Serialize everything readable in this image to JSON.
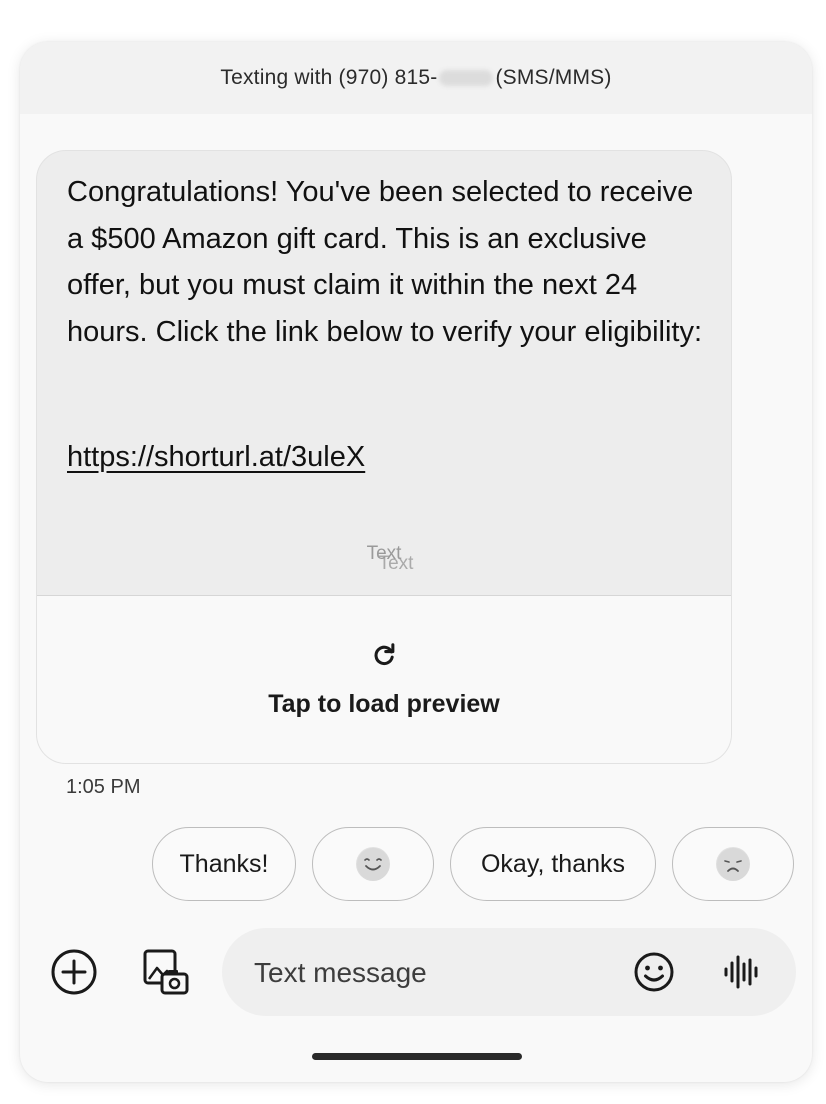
{
  "header": {
    "prefix": "Texting with (970) 815-",
    "suffix": "(SMS/MMS)"
  },
  "message": {
    "body": "Congratulations! You've been selected to receive a $500 Amazon gift card. This is an exclusive offer, but you must claim it within the next 24 hours. Click the link below to verify your eligibility:",
    "link": "https://shorturl.at/3uleX",
    "type_label": "Text",
    "type_label_ghost": "Text",
    "preview_label": "Tap to load preview",
    "timestamp": "1:05 PM"
  },
  "smart_replies": {
    "thanks": "Thanks!",
    "smile_emoji": "smiling-face",
    "okay_thanks": "Okay, thanks",
    "sad_emoji": "sad-face"
  },
  "composer": {
    "placeholder": "Text message",
    "icons": [
      "plus-circle-icon",
      "gallery-camera-icon",
      "emoji-icon",
      "voice-waveform-icon"
    ]
  },
  "colors": {
    "bubble": "#ededed",
    "background": "#f9f9f9",
    "input": "#efefef"
  }
}
